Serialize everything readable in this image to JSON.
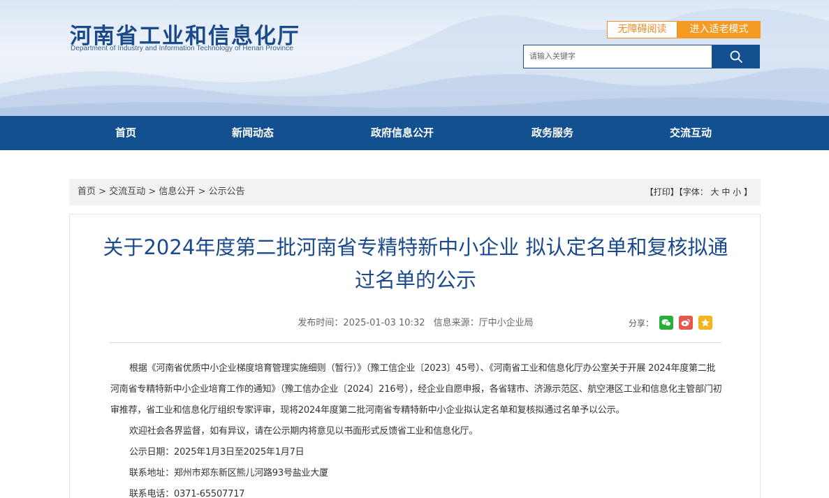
{
  "site": {
    "name_cn": "河南省工业和信息化厅",
    "name_en": "Department of Industry and Information Technology of Henan Province"
  },
  "top_buttons": {
    "accessibility": "无障碍阅读",
    "elder_mode": "进入适老模式"
  },
  "search": {
    "placeholder": "请输入关键字",
    "icon": "search-icon"
  },
  "nav": {
    "items": [
      "首页",
      "新闻动态",
      "政府信息公开",
      "政务服务",
      "交流互动"
    ]
  },
  "breadcrumb": {
    "items": [
      "首页",
      "交流互动",
      "信息公开",
      "公示公告"
    ],
    "separator": ">",
    "tools": "【打印】【字体： 大 中 小 】"
  },
  "article": {
    "title": "关于2024年度第二批河南省专精特新中小企业 拟认定名单和复核拟通过名单的公示",
    "publish_time": "发布时间：2025-01-03 10:32",
    "source": "信息来源：厅中小企业局",
    "share_label": "分享：",
    "share_icons": [
      "wechat-icon",
      "weibo-icon",
      "favorite-icon"
    ],
    "paragraphs": [
      "根据《河南省优质中小企业梯度培育管理实施细则（暂行）》（豫工信企业〔2023〕45号）、《河南省工业和信息化厅办公室关于开展 2024年度第二批河南省专精特新中小企业培育工作的通知》（豫工信办企业〔2024〕216号），经企业自愿申报，各省辖市、济源示范区、航空港区工业和信息化主管部门初审推荐，省工业和信息化厅组织专家评审，现将2024年度第二批河南省专精特新中小企业拟认定名单和复核拟通过名单予以公示。",
      "欢迎社会各界监督，如有异议，请在公示期内将意见以书面形式反馈省工业和信息化厅。",
      "公示日期：2025年1月3日至2025年1月7日",
      "联系地址：郑州市郑东新区熊儿河路93号盐业大厦",
      "联系电话：0371-65507717"
    ]
  },
  "colors": {
    "brand_blue": "#12508f",
    "title_blue": "#1a4a8c",
    "accent_orange": "#f59a23",
    "wechat_green": "#2aae3a",
    "weibo_red": "#e5574b",
    "favorite_yellow": "#f2b51b"
  }
}
